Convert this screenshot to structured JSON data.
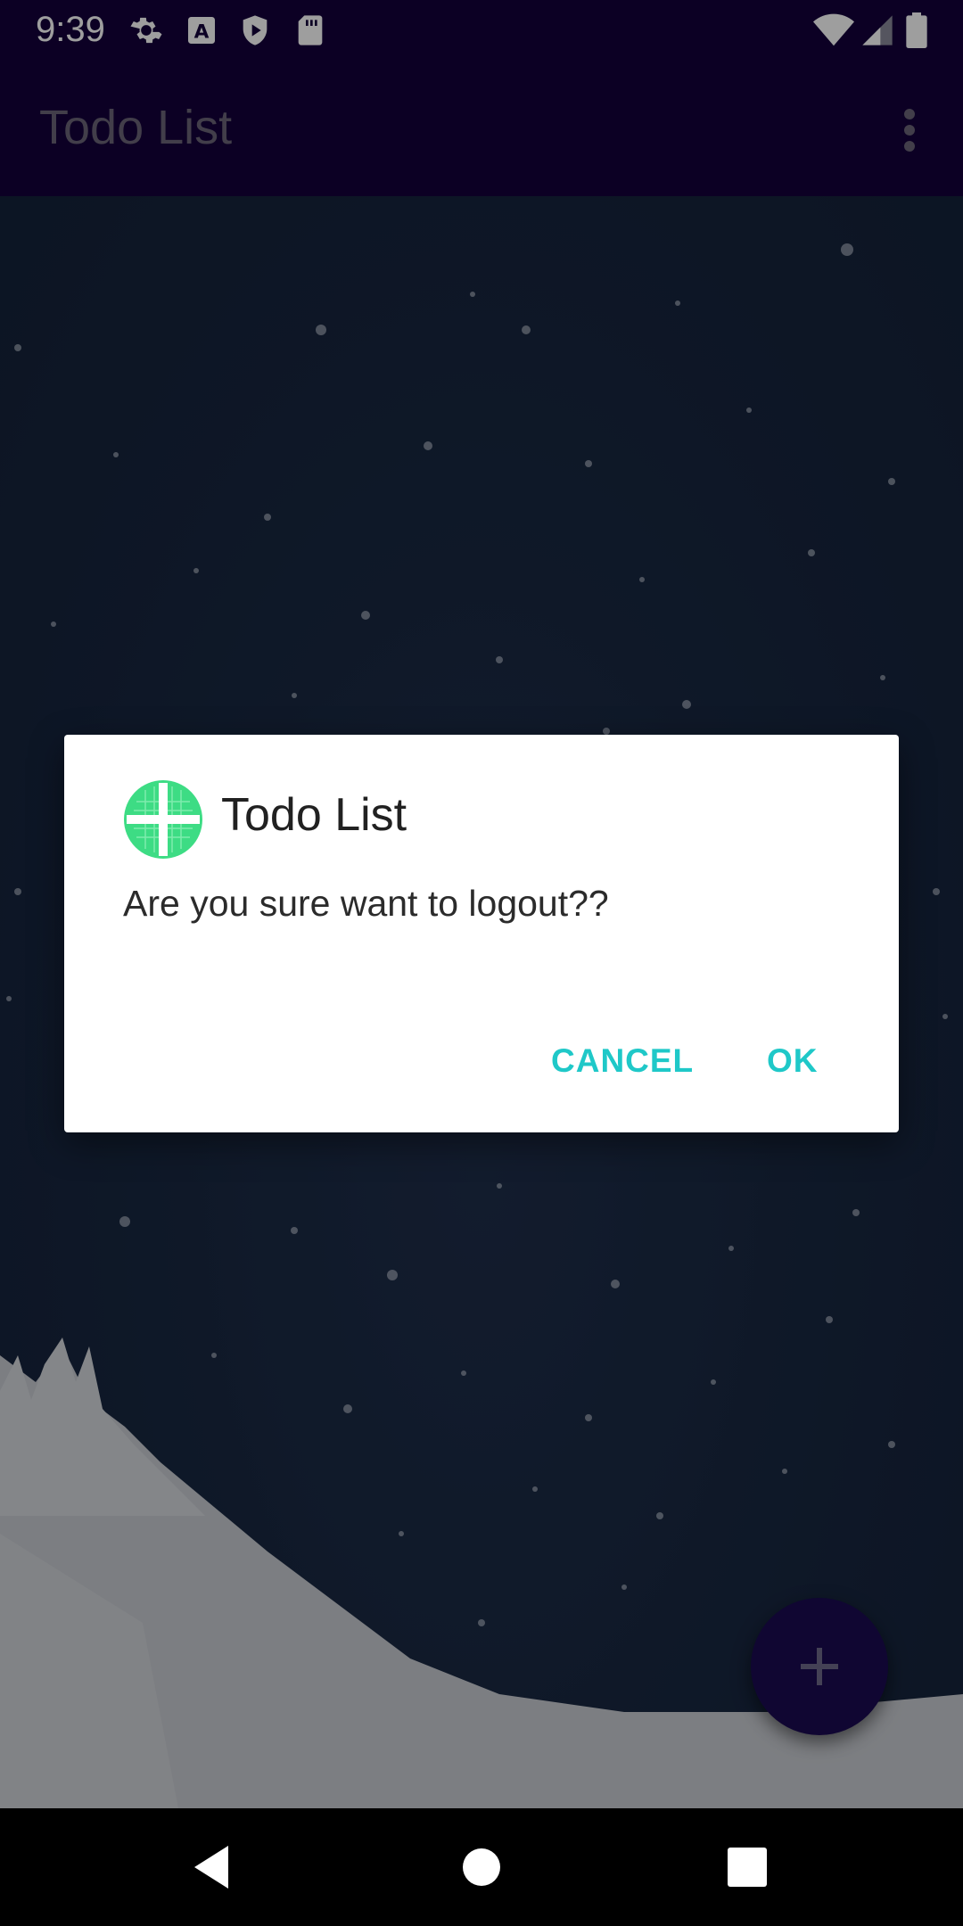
{
  "status_bar": {
    "time": "9:39",
    "icons_left": [
      "settings-icon",
      "a-icon",
      "shield-play-icon",
      "sd-card-icon"
    ],
    "icons_right": [
      "wifi-icon",
      "signal-icon",
      "battery-icon"
    ]
  },
  "app_bar": {
    "title": "Todo List",
    "menu_icon": "overflow-menu-icon"
  },
  "dialog": {
    "icon": "app-logo-icon",
    "title": "Todo List",
    "message": "Are you sure want to logout??",
    "cancel_label": "CANCEL",
    "ok_label": "OK",
    "accent_color": "#1fc8c8"
  },
  "fab": {
    "icon": "plus-icon"
  },
  "nav_bar": {
    "back_icon": "back-icon",
    "home_icon": "home-icon",
    "recents_icon": "recents-icon"
  },
  "colors": {
    "primary": "#14003a",
    "fab": "#1a0a52",
    "logo": "#3ddc84"
  }
}
